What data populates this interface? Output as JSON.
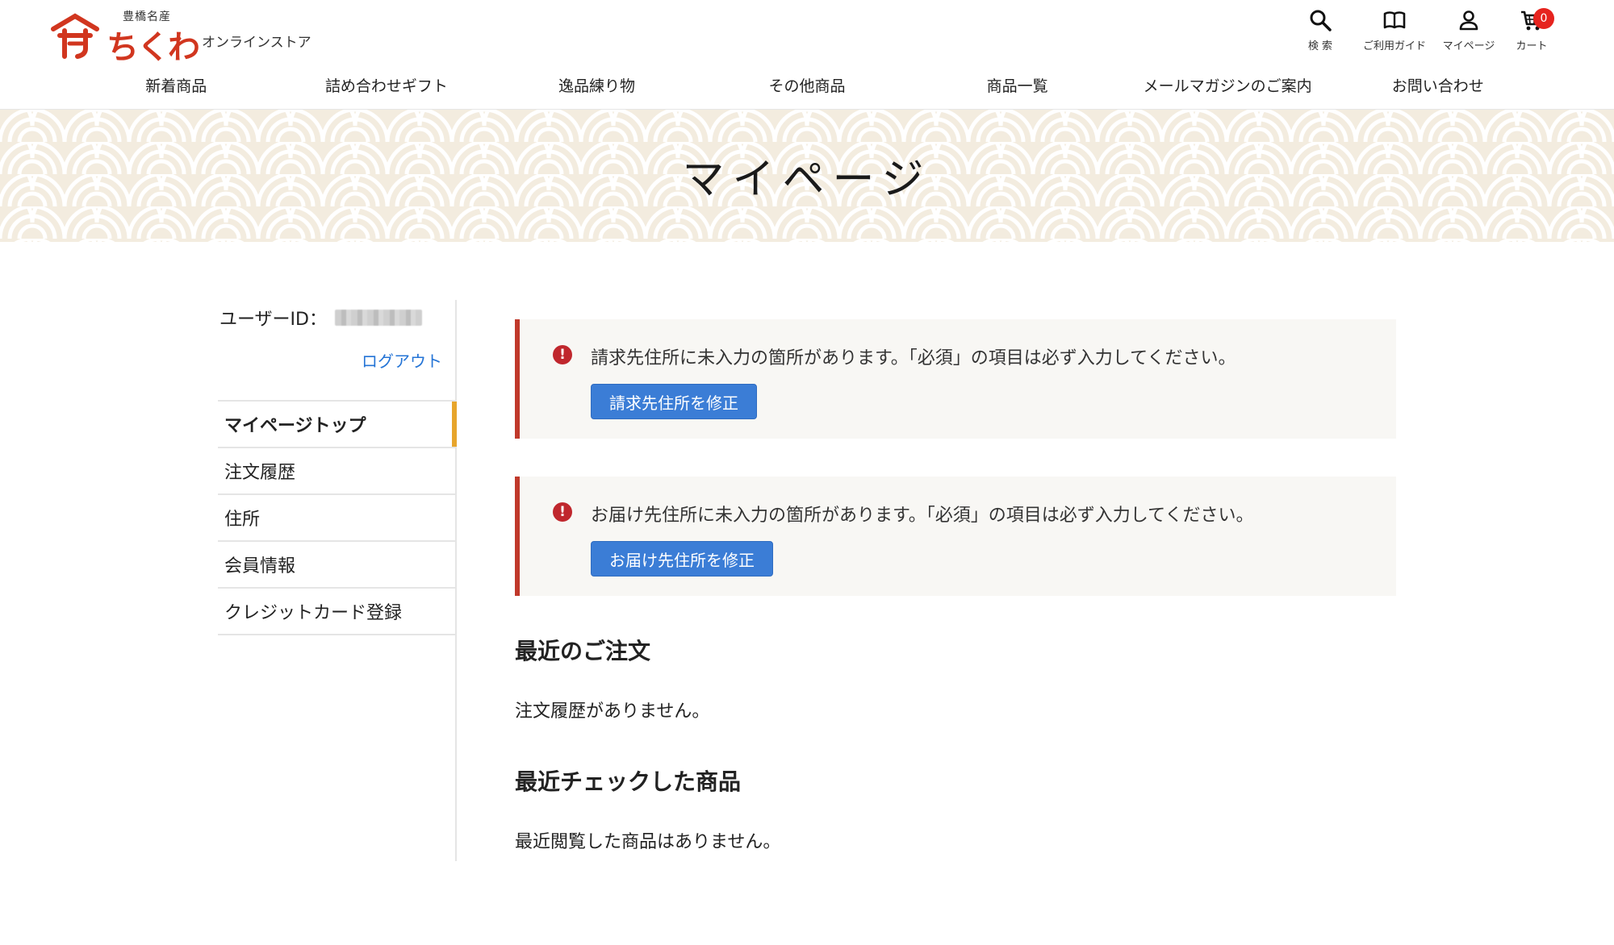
{
  "header": {
    "logo": {
      "small": "豊橋名産",
      "main": "ちくわ",
      "sub": "オンラインストア"
    },
    "icons": [
      {
        "name": "search-icon",
        "label": "検 索"
      },
      {
        "name": "book-icon",
        "label": "ご利用ガイド"
      },
      {
        "name": "user-icon",
        "label": "マイページ"
      },
      {
        "name": "cart-icon",
        "label": "カート",
        "badge": "0"
      }
    ],
    "nav": [
      "新着商品",
      "詰め合わせギフト",
      "逸品練り物",
      "その他商品",
      "商品一覧",
      "メールマガジンのご案内",
      "お問い合わせ"
    ]
  },
  "banner": {
    "title": "マイページ"
  },
  "sidebar": {
    "userid_label": "ユーザーID：",
    "logout": "ログアウト",
    "menu": [
      "マイページトップ",
      "注文履歴",
      "住所",
      "会員情報",
      "クレジットカード登録"
    ]
  },
  "main": {
    "alerts": [
      {
        "message": "請求先住所に未入力の箇所があります。「必須」の項目は必ず入力してください。",
        "button": "請求先住所を修正"
      },
      {
        "message": "お届け先住所に未入力の箇所があります。「必須」の項目は必ず入力してください。",
        "button": "お届け先住所を修正"
      }
    ],
    "recent_orders": {
      "title": "最近のご注文",
      "empty": "注文履歴がありません。"
    },
    "recent_viewed": {
      "title": "最近チェックした商品",
      "empty": "最近閲覧した商品はありません。"
    }
  },
  "colors": {
    "brand_red": "#d1361f",
    "link_blue": "#2474d6",
    "button_blue": "#3b7dd6",
    "alert_red": "#c0392b",
    "active_marker": "#e7a52c",
    "banner_bg": "#f3ecdf"
  }
}
